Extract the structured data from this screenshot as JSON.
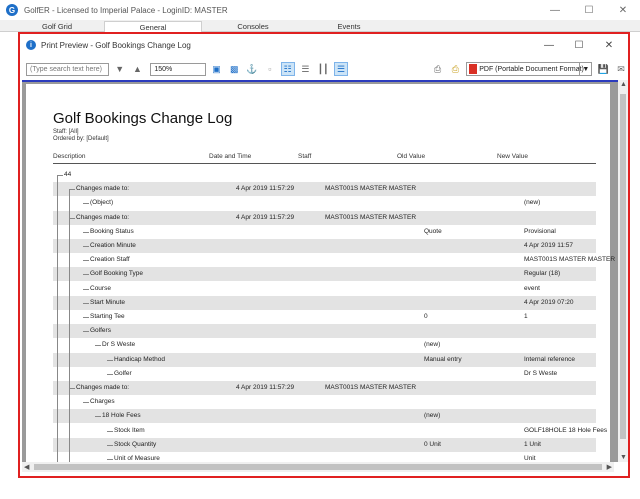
{
  "app": {
    "title": "GolfER - Licensed to Imperial Palace - LoginID: MASTER",
    "icon_label": "G"
  },
  "tabs": [
    {
      "label": "Golf Grid"
    },
    {
      "label": "General"
    },
    {
      "label": "Consoles"
    },
    {
      "label": "Events"
    }
  ],
  "preview": {
    "title": "Print Preview - Golf Bookings Change Log",
    "icon_label": "i",
    "search_placeholder": "(Type search text here)",
    "zoom": "150%",
    "export_format": "PDF (Portable Document Format)"
  },
  "report": {
    "title": "Golf Bookings Change Log",
    "staff_line": "Staff: [All]",
    "ordered_line": "Ordered by: [Default]",
    "columns": [
      "Description",
      "Date and Time",
      "Staff",
      "Old Value",
      "New Value"
    ],
    "rows": [
      {
        "desc": "44",
        "indent": 0,
        "date": "",
        "staff": "",
        "old": "",
        "new": ""
      },
      {
        "desc": "Changes made to:",
        "indent": 1,
        "date": "4 Apr 2019 11:57:29",
        "staff": "MAST001S MASTER MASTER",
        "old": "",
        "new": ""
      },
      {
        "desc": "(Object)",
        "indent": 2,
        "date": "",
        "staff": "",
        "old": "",
        "new": "(new)"
      },
      {
        "desc": "Changes made to:",
        "indent": 1,
        "date": "4 Apr 2019 11:57:29",
        "staff": "MAST001S MASTER MASTER",
        "old": "",
        "new": ""
      },
      {
        "desc": "Booking Status",
        "indent": 2,
        "date": "",
        "staff": "",
        "old": "Quote",
        "new": "Provisional"
      },
      {
        "desc": "Creation Minute",
        "indent": 2,
        "date": "",
        "staff": "",
        "old": "",
        "new": "4 Apr 2019 11:57"
      },
      {
        "desc": "Creation Staff",
        "indent": 2,
        "date": "",
        "staff": "",
        "old": "",
        "new": "MAST001S MASTER MASTER"
      },
      {
        "desc": "Golf Booking Type",
        "indent": 2,
        "date": "",
        "staff": "",
        "old": "",
        "new": "Regular (18)"
      },
      {
        "desc": "Course",
        "indent": 2,
        "date": "",
        "staff": "",
        "old": "",
        "new": "event"
      },
      {
        "desc": "Start Minute",
        "indent": 2,
        "date": "",
        "staff": "",
        "old": "",
        "new": "4 Apr 2019 07:20"
      },
      {
        "desc": "Starting Tee",
        "indent": 2,
        "date": "",
        "staff": "",
        "old": "0",
        "new": "1"
      },
      {
        "desc": "Golfers",
        "indent": 2,
        "date": "",
        "staff": "",
        "old": "",
        "new": ""
      },
      {
        "desc": "Dr S Weste",
        "indent": 3,
        "date": "",
        "staff": "",
        "old": "(new)",
        "new": ""
      },
      {
        "desc": "Handicap Method",
        "indent": 4,
        "date": "",
        "staff": "",
        "old": "Manual entry",
        "new": "Internal reference"
      },
      {
        "desc": "Golfer",
        "indent": 4,
        "date": "",
        "staff": "",
        "old": "",
        "new": "Dr S Weste"
      },
      {
        "desc": "Changes made to:",
        "indent": 1,
        "date": "4 Apr 2019 11:57:29",
        "staff": "MAST001S MASTER MASTER",
        "old": "",
        "new": ""
      },
      {
        "desc": "Charges",
        "indent": 2,
        "date": "",
        "staff": "",
        "old": "",
        "new": ""
      },
      {
        "desc": "18 Hole Fees",
        "indent": 3,
        "date": "",
        "staff": "",
        "old": "(new)",
        "new": ""
      },
      {
        "desc": "Stock Item",
        "indent": 4,
        "date": "",
        "staff": "",
        "old": "",
        "new": "GOLF18HOLE 18 Hole Fees"
      },
      {
        "desc": "Stock Quantity",
        "indent": 4,
        "date": "",
        "staff": "",
        "old": "0 Unit",
        "new": "1 Unit"
      },
      {
        "desc": "Unit of Measure",
        "indent": 4,
        "date": "",
        "staff": "",
        "old": "",
        "new": "Unit"
      }
    ]
  },
  "icons": {
    "minimize": "minimize-icon",
    "maximize": "maximize-icon",
    "close": "close-icon"
  }
}
